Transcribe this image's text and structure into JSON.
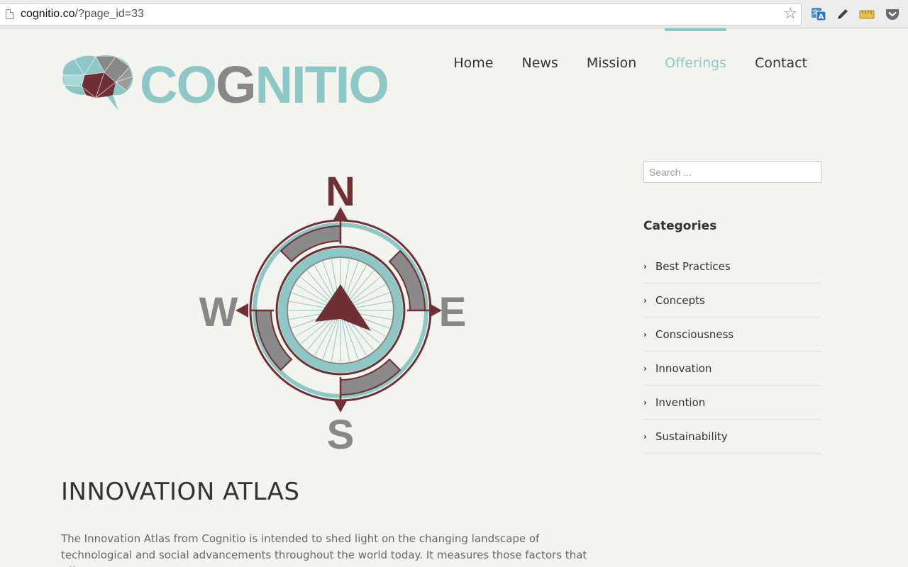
{
  "browser": {
    "url_domain": "cognitio.co",
    "url_path": "/?page_id=33",
    "extensions": [
      "translate-icon",
      "pencil-icon",
      "ruler-icon",
      "pocket-icon"
    ]
  },
  "site": {
    "logo_text_before": "CO",
    "logo_text_g": "G",
    "logo_text_after": "NITIO",
    "brand_color": "#8ec8c6",
    "accent_color": "#6f3035",
    "gray_color": "#888888"
  },
  "nav": {
    "items": [
      {
        "label": "Home",
        "active": false
      },
      {
        "label": "News",
        "active": false
      },
      {
        "label": "Mission",
        "active": false
      },
      {
        "label": "Offerings",
        "active": true
      },
      {
        "label": "Contact",
        "active": false
      }
    ]
  },
  "compass": {
    "north": "N",
    "south": "S",
    "east": "E",
    "west": "W"
  },
  "content": {
    "title": "INNOVATION ATLAS",
    "paragraph": "The Innovation Atlas from Cognitio is intended to shed light on the changing landscape of technological and social advancements throughout the world today. It measures those factors that affect a country's"
  },
  "sidebar": {
    "search_placeholder": "Search ...",
    "categories_title": "Categories",
    "categories": [
      "Best Practices",
      "Concepts",
      "Consciousness",
      "Innovation",
      "Invention",
      "Sustainability"
    ]
  }
}
